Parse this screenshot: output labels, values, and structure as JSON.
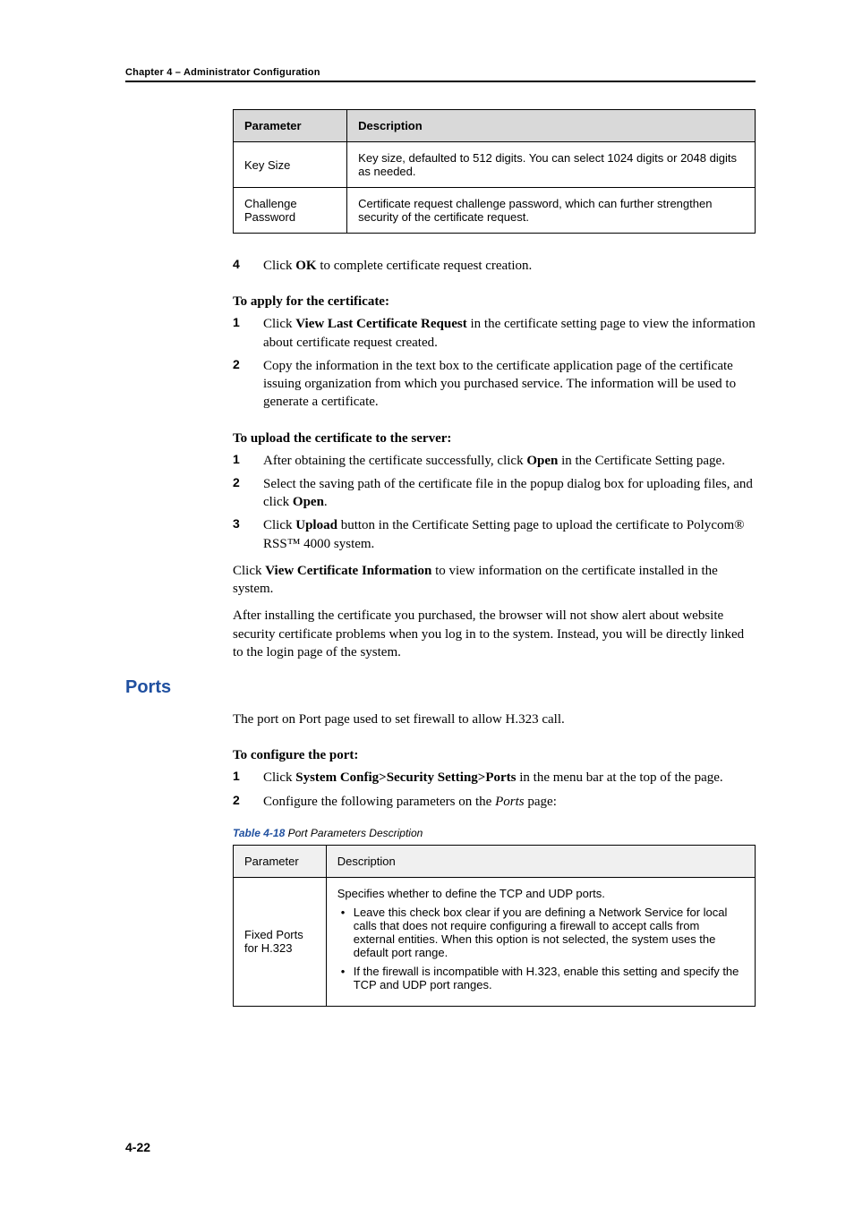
{
  "header": {
    "chapter": "Chapter 4 – Administrator Configuration"
  },
  "tables": {
    "cert": {
      "headers": {
        "param": "Parameter",
        "desc": "Description"
      },
      "rows": [
        {
          "param": "Key Size",
          "desc": "Key size, defaulted to 512 digits. You can select 1024 digits or 2048 digits as needed."
        },
        {
          "param": "Challenge Password",
          "desc": "Certificate request challenge password, which can further strengthen security of the certificate request."
        }
      ]
    },
    "ports": {
      "headers": {
        "param": "Parameter",
        "desc": "Description"
      },
      "rows": [
        {
          "param": "Fixed Ports for H.323",
          "intro": "Specifies whether to define the TCP and UDP ports.",
          "bullets": [
            "Leave this check box clear if you are defining a Network Service for local calls that does not require configuring a firewall to accept calls from external entities. When this option is not selected, the system uses the default port range.",
            "If the firewall is incompatible with H.323, enable this setting and specify the TCP and UDP port ranges."
          ]
        }
      ]
    }
  },
  "steps": {
    "initial": [
      {
        "num": "4",
        "pre": "Click ",
        "bold": "OK",
        "post": " to complete certificate request creation."
      }
    ],
    "apply_heading": "To apply for the certificate:",
    "apply": [
      {
        "num": "1",
        "pre": "Click ",
        "bold": "View Last Certificate Request",
        "post": " in the certificate setting page to view the information about certificate request created."
      },
      {
        "num": "2",
        "pre": "",
        "bold": "",
        "post": "Copy the information in the text box to the certificate application page of the certificate issuing organization from which you purchased service. The information will be used to generate a certificate."
      }
    ],
    "upload_heading": "To upload the certificate to the server:",
    "upload": [
      {
        "num": "1",
        "pre": "After obtaining the certificate successfully, click ",
        "bold": "Open",
        "post": " in the Certificate Setting page."
      },
      {
        "num": "2",
        "pre": "Select the saving path of the certificate file in the popup dialog box for uploading files, and click ",
        "bold": "Open",
        "post": "."
      },
      {
        "num": "3",
        "pre": "Click ",
        "bold": "Upload",
        "post": " button in the Certificate Setting page to upload the certificate to Polycom® RSS™ 4000 system."
      }
    ],
    "after_upload_p1_pre": "Click ",
    "after_upload_p1_bold": "View Certificate Information",
    "after_upload_p1_post": " to view information on the certificate installed in the system.",
    "after_upload_p2": "After installing the certificate you purchased, the browser will not show alert about website security certificate problems when you log in to the system. Instead, you will be directly linked to the login page of the system."
  },
  "ports_section": {
    "title": "Ports",
    "intro": "The port on Port page used to set firewall to allow H.323 call.",
    "configure_heading": "To configure the port:",
    "steps": [
      {
        "num": "1",
        "pre": "Click ",
        "bold": "System Config>Security Setting>Ports",
        "post": " in the menu bar at the top of the page."
      },
      {
        "num": "2",
        "pre": "Configure the following parameters on the ",
        "italic": "Ports",
        "post": " page:"
      }
    ],
    "table_caption_label": "Table 4-18",
    "table_caption_text": " Port Parameters Description"
  },
  "footer": {
    "page": "4-22"
  }
}
